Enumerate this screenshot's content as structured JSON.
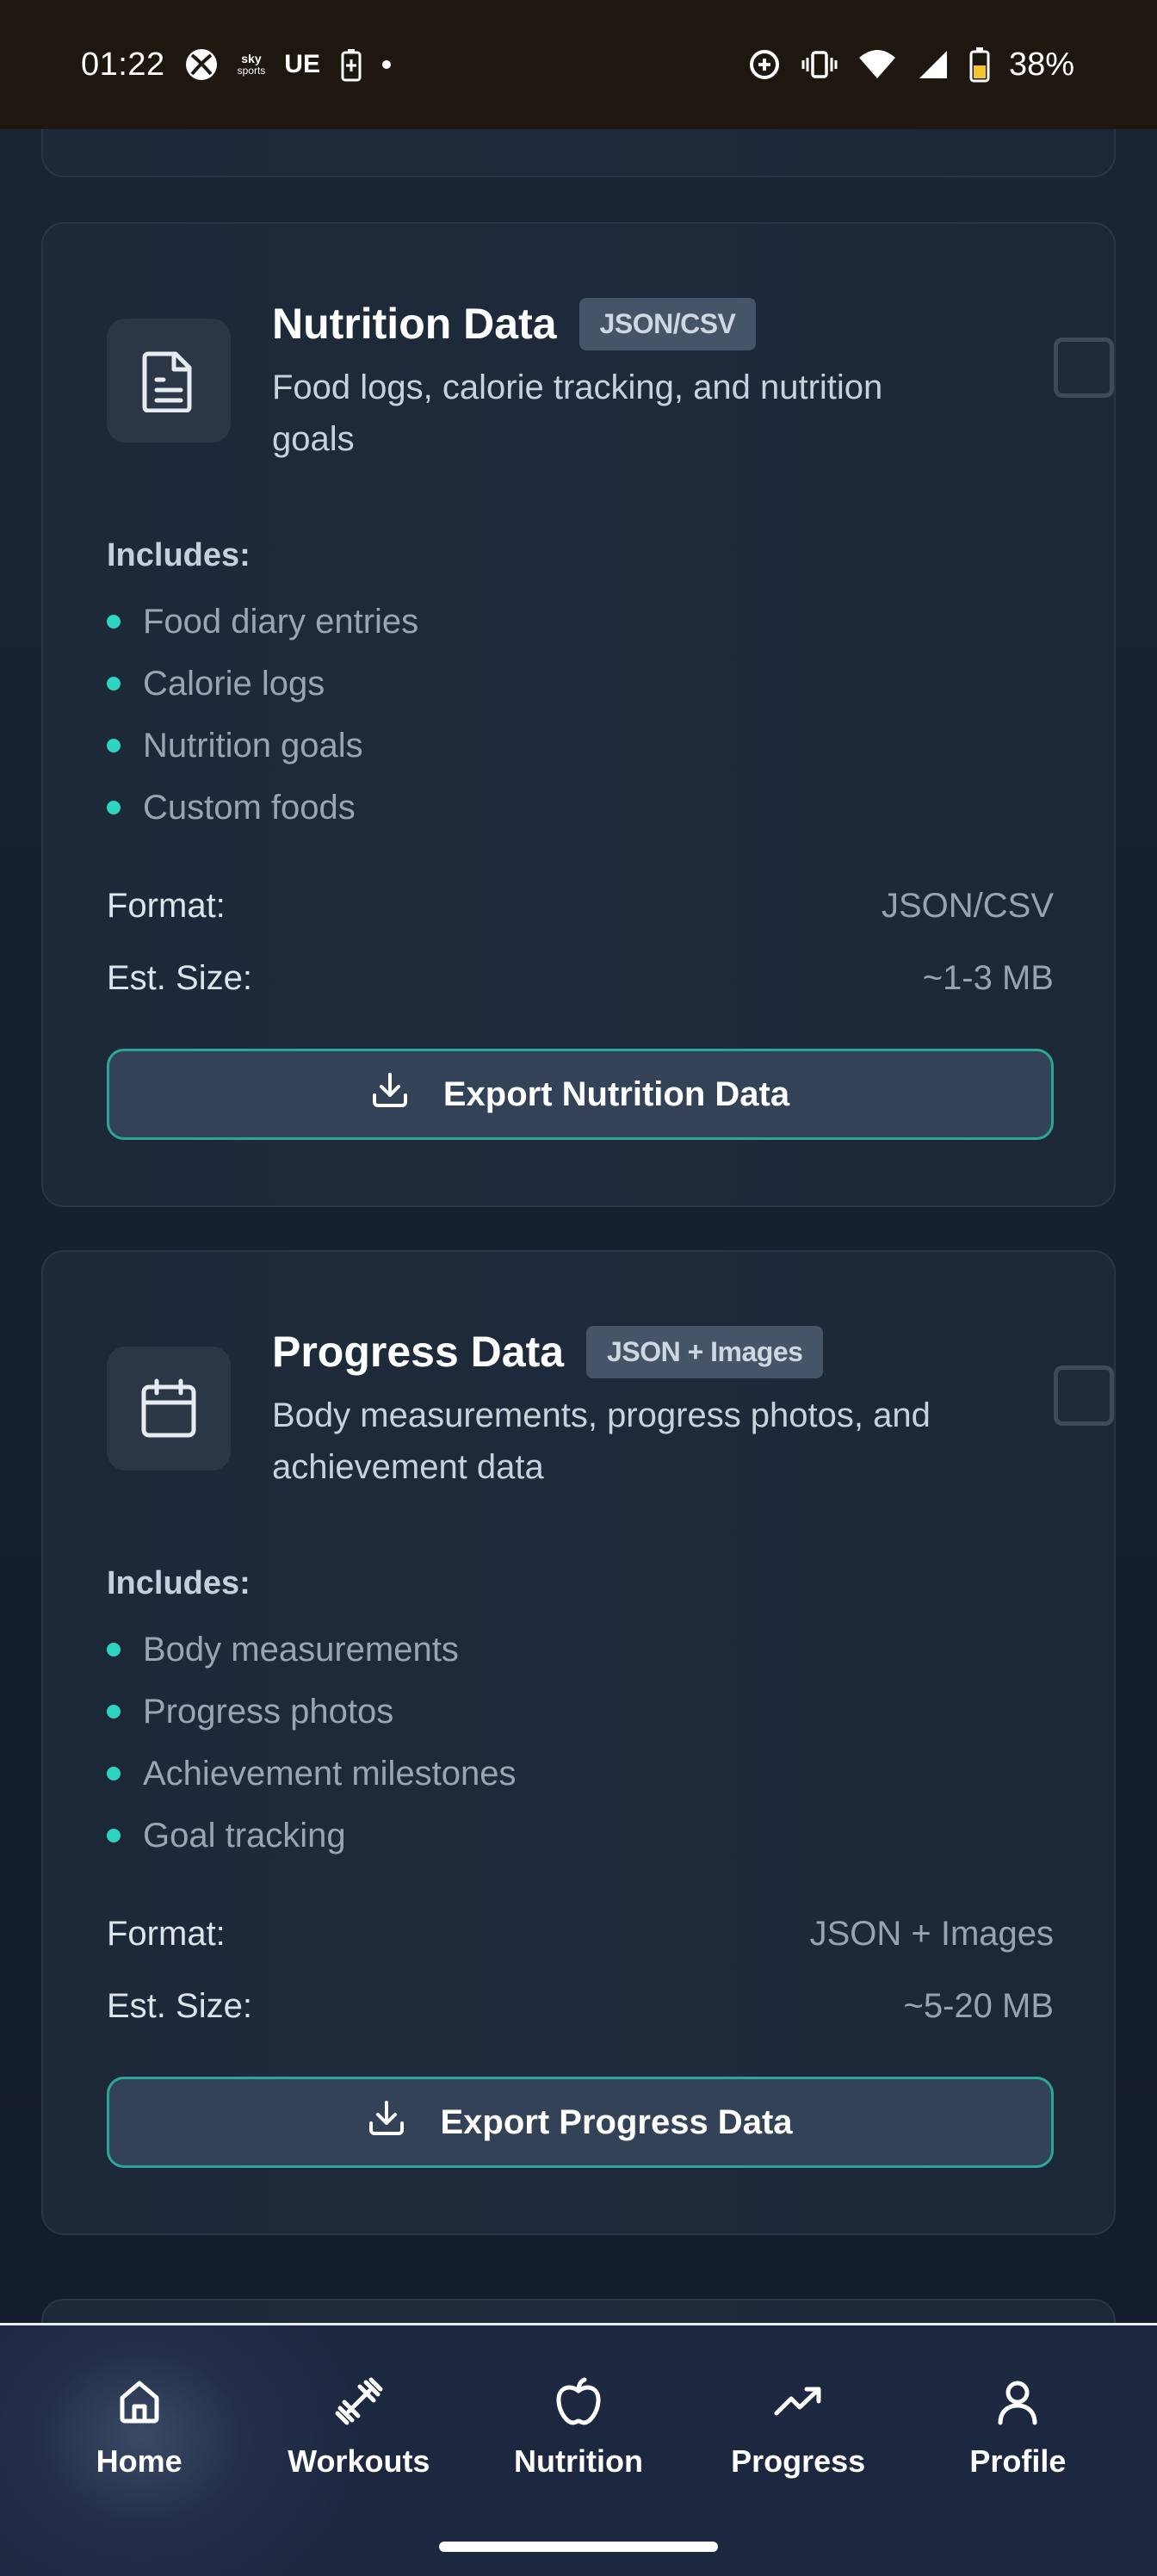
{
  "status_bar": {
    "time": "01:22",
    "sky_sports_line1": "sky",
    "sky_sports_line2": "sports",
    "ue_label": "UE",
    "battery_percent": "38%",
    "icons": [
      "xbox-icon",
      "sky-sports-icon",
      "battery-saver-icon",
      "dot-icon",
      "data-saver-icon",
      "vibrate-icon",
      "wifi-icon",
      "cell-signal-icon",
      "battery-icon"
    ]
  },
  "cards": [
    {
      "id": "nutrition",
      "icon": "document-icon",
      "title": "Nutrition Data",
      "badge": "JSON/CSV",
      "description": "Food logs, calorie tracking, and nutrition goals",
      "includes_label": "Includes:",
      "items": [
        "Food diary entries",
        "Calorie logs",
        "Nutrition goals",
        "Custom foods"
      ],
      "format_label": "Format:",
      "format_value": "JSON/CSV",
      "size_label": "Est. Size:",
      "size_value": "~1-3 MB",
      "button_label": "Export Nutrition Data",
      "checked": false
    },
    {
      "id": "progress",
      "icon": "calendar-icon",
      "title": "Progress Data",
      "badge": "JSON + Images",
      "description": "Body measurements, progress photos, and achievement data",
      "includes_label": "Includes:",
      "items": [
        "Body measurements",
        "Progress photos",
        "Achievement milestones",
        "Goal tracking"
      ],
      "format_label": "Format:",
      "format_value": "JSON + Images",
      "size_label": "Est. Size:",
      "size_value": "~5-20 MB",
      "button_label": "Export Progress Data",
      "checked": false
    }
  ],
  "nav": {
    "items": [
      {
        "label": "Home",
        "icon": "home-icon",
        "active": true
      },
      {
        "label": "Workouts",
        "icon": "dumbbell-icon",
        "active": false
      },
      {
        "label": "Nutrition",
        "icon": "apple-icon",
        "active": false
      },
      {
        "label": "Progress",
        "icon": "trending-up-icon",
        "active": false
      },
      {
        "label": "Profile",
        "icon": "user-icon",
        "active": false
      }
    ]
  },
  "colors": {
    "accent": "#2dd4bf",
    "button_border": "#2aa797",
    "card_bg": "#1e2a3b",
    "page_bg": "#162030"
  }
}
